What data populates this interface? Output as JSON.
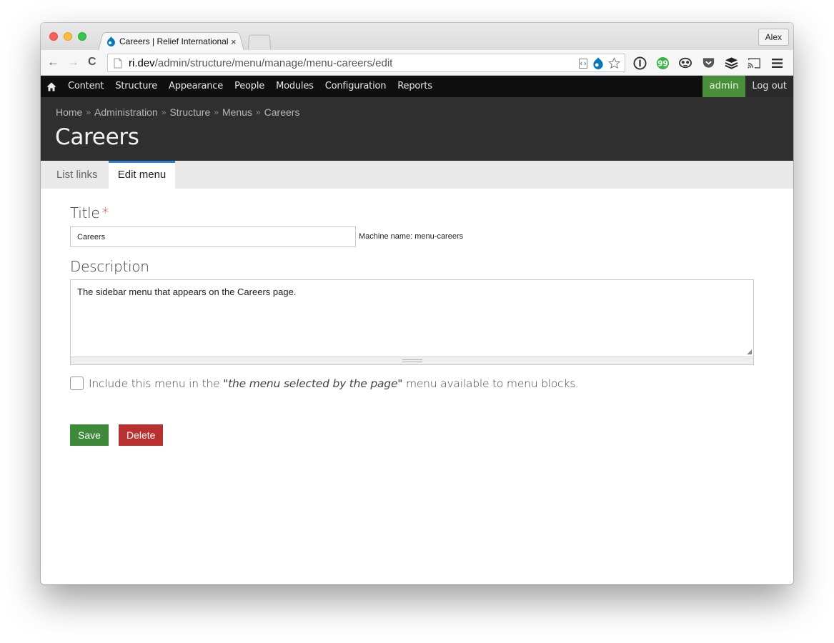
{
  "browser": {
    "tab_title": "Careers | Relief International",
    "tab_close": "×",
    "profile": "Alex",
    "url_host": "ri.dev",
    "url_path": "/admin/structure/menu/manage/menu-careers/edit"
  },
  "toolbar": {
    "items": [
      "Content",
      "Structure",
      "Appearance",
      "People",
      "Modules",
      "Configuration",
      "Reports"
    ],
    "user": "admin",
    "logout": "Log out"
  },
  "header": {
    "breadcrumb": [
      "Home",
      "Administration",
      "Structure",
      "Menus",
      "Careers"
    ],
    "breadcrumb_sep": "»",
    "title": "Careers"
  },
  "tabs": {
    "list_links": "List links",
    "edit_menu": "Edit menu"
  },
  "form": {
    "title_label": "Title",
    "required_mark": "*",
    "title_value": "Careers",
    "machine_name": "Machine name: menu-careers",
    "description_label": "Description",
    "description_value": "The sidebar menu that appears on the Careers page.",
    "checkbox_prefix": "Include this menu in the ",
    "checkbox_italic": "\"the menu selected by the page\"",
    "checkbox_suffix": " menu available to menu blocks.",
    "save_label": "Save",
    "delete_label": "Delete"
  },
  "colors": {
    "save": "#3c8a3a",
    "delete": "#b8302f",
    "active_tab": "#2e7fcf",
    "user_badge": "#4a8f3a"
  },
  "icons": [
    "drupal-icon",
    "home-icon",
    "star-icon",
    "onepassword-icon",
    "evernote-icon",
    "pocket-icon",
    "buffer-icon",
    "cast-icon",
    "menu-icon"
  ]
}
